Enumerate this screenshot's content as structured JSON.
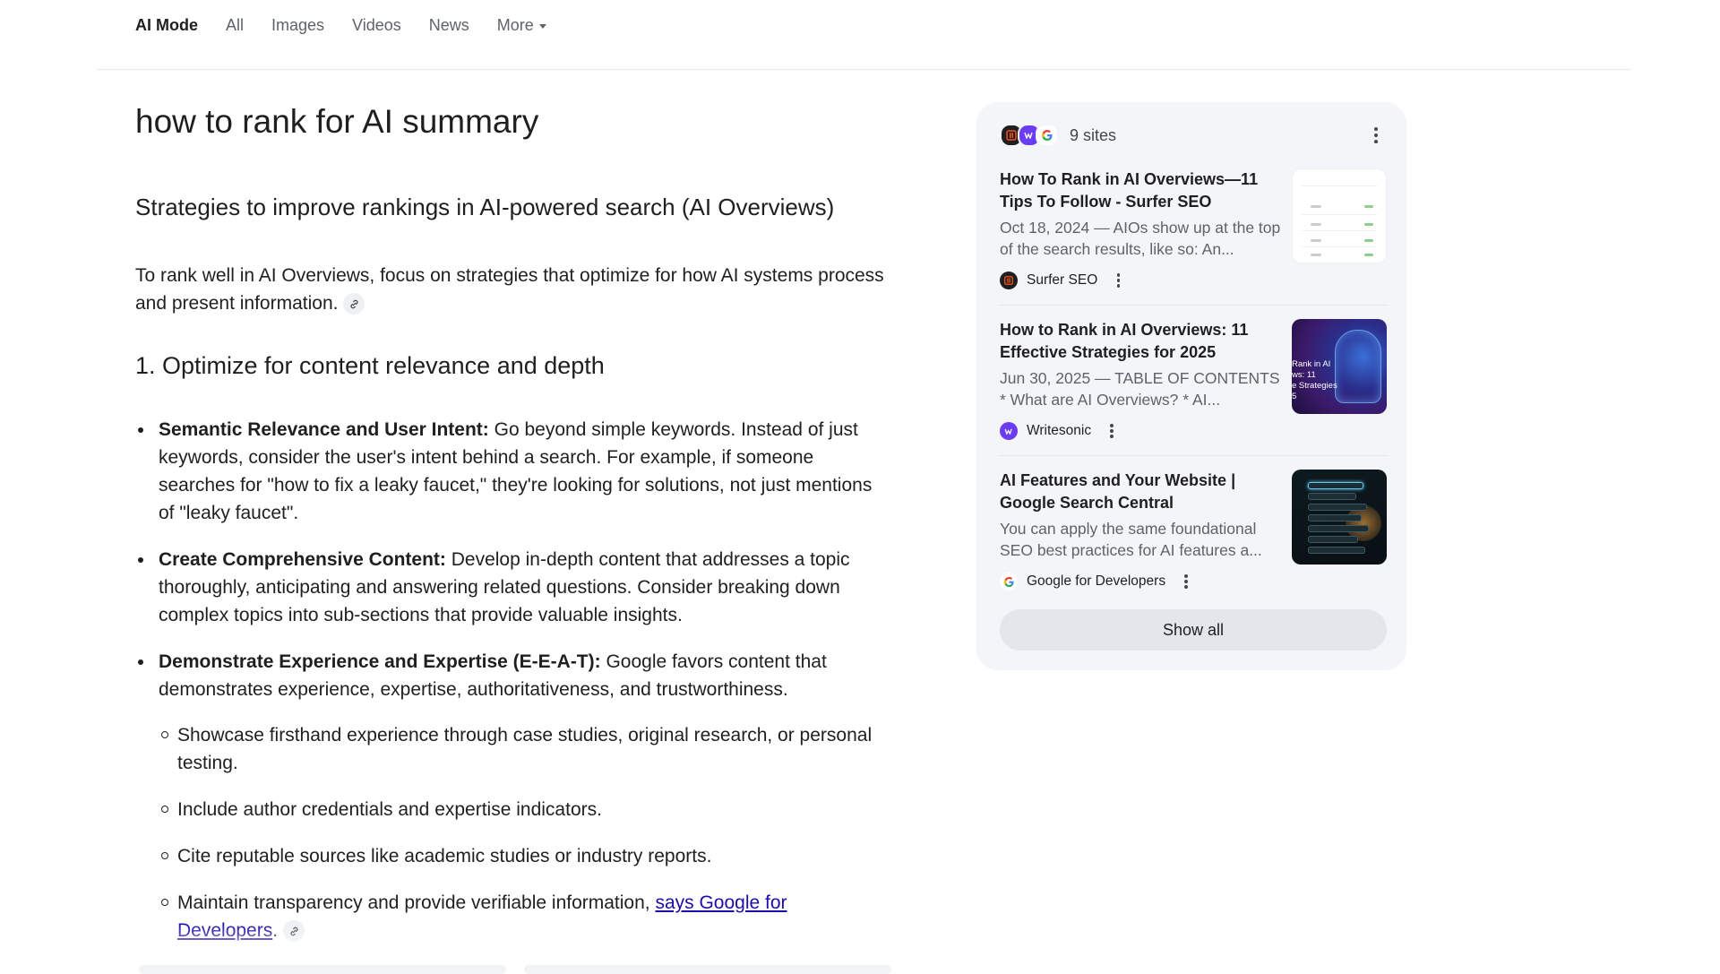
{
  "nav": {
    "tabs": [
      {
        "label": "AI Mode",
        "active": true
      },
      {
        "label": "All"
      },
      {
        "label": "Images"
      },
      {
        "label": "Videos"
      },
      {
        "label": "News"
      }
    ],
    "more_label": "More"
  },
  "query": "how to rank for AI summary",
  "answer": {
    "heading": "Strategies to improve rankings in AI-powered search (AI Overviews)",
    "intro": "To rank well in AI Overviews, focus on strategies that optimize for how AI systems process and present information.",
    "section1_heading": "1. Optimize for content relevance and depth",
    "bullets": [
      {
        "bold": "Semantic Relevance and User Intent:",
        "text": " Go beyond simple keywords. Instead of just keywords, consider the user's intent behind a search. For example, if someone searches for \"how to fix a leaky faucet,\" they're looking for solutions, not just mentions of \"leaky faucet\"."
      },
      {
        "bold": "Create Comprehensive Content:",
        "text": " Develop in-depth content that addresses a topic thoroughly, anticipating and answering related questions. Consider breaking down complex topics into sub-sections that provide valuable insights."
      },
      {
        "bold": "Demonstrate Experience and Expertise (E-E-A-T):",
        "text": " Google favors content that demonstrates experience, expertise, authoritativeness, and trustworthiness."
      }
    ],
    "sub_bullets": [
      "Showcase firsthand experience through case studies, original research, or personal testing.",
      "Include author credentials and expertise indicators.",
      "Cite reputable sources like academic studies or industry reports."
    ],
    "last_sub_bullet": {
      "text": "Maintain transparency and provide verifiable information, ",
      "link": "says Google for Developers",
      "end": "."
    }
  },
  "sources": {
    "count_label": "9 sites",
    "items": [
      {
        "title": "How To Rank in AI Overviews—11 Tips To Follow - Surfer SEO",
        "snippet": "Oct 18, 2024 — AIOs show up at the top of the search results, like so: An...",
        "site": "Surfer SEO",
        "icon": "surfer-seo-logo"
      },
      {
        "title": "How to Rank in AI Overviews: 11 Effective Strategies for 2025",
        "snippet": "Jun 30, 2025 — TABLE OF CONTENTS * What are AI Overviews? * AI...",
        "site": "Writesonic",
        "icon": "writesonic-logo",
        "thumb_text": "Rank in AI\nws: 11\ne Strategies\n5"
      },
      {
        "title": "AI Features and Your Website | Google Search Central",
        "snippet": "You can apply the same foundational SEO best practices for AI features a...",
        "site": "Google for Developers",
        "icon": "google-logo"
      }
    ],
    "show_all_label": "Show all"
  },
  "colors": {
    "link": "#1a0dab",
    "panel_bg": "#f3f5f8",
    "muted_text": "#5f6368"
  }
}
